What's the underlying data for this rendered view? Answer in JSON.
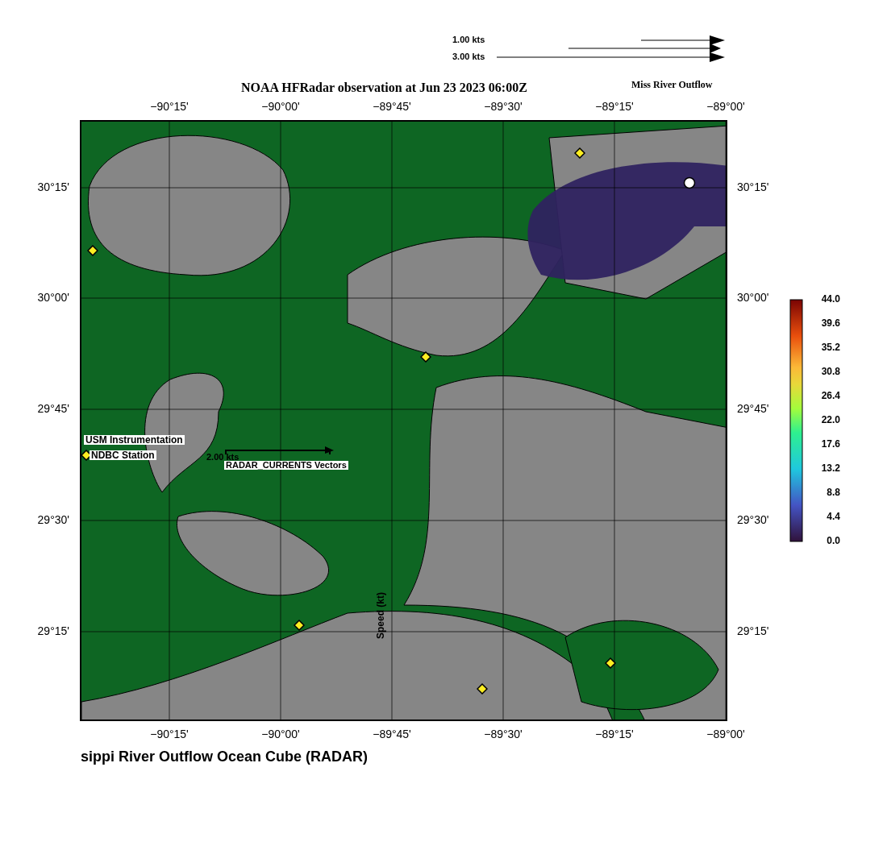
{
  "scale_legend": [
    {
      "label": "1.00 kts"
    },
    {
      "label": "3.00 kts"
    }
  ],
  "title": "NOAA HFRadar observation at Jun 23 2023 06:00Z",
  "subtitle": "Miss River Outflow",
  "map": {
    "kind": "picture",
    "top_ticks": [
      "−90°15'",
      "−90°00'",
      "−89°45'",
      "−89°30'",
      "−89°15'",
      "−89°00'"
    ],
    "left_ticks": [
      "30°15'",
      "30°00'",
      "29°45'",
      "29°30'",
      "29°15'"
    ],
    "right_ticks": [
      "30°15'",
      "30°00'",
      "29°45'",
      "29°30'",
      "29°15'"
    ],
    "bottom_ticks": [
      "−90°15'",
      "−90°00'",
      "−89°45'",
      "−89°30'",
      "−89°15'",
      "−89°00'"
    ],
    "legend_labels": [
      "USM Instrumentation",
      "NDBC Station"
    ],
    "vector_scale": "2.00 kts",
    "vector_label": "RADAR_CURRENTS Vectors",
    "speed_label": "Speed (kt)"
  },
  "colorbar": {
    "ticks": [
      "44.0",
      "39.6",
      "35.2",
      "30.8",
      "26.4",
      "22.0",
      "17.6",
      "13.2",
      "8.8",
      "4.4",
      "0.0"
    ]
  },
  "caption": "sippi River Outflow Ocean Cube (RADAR)"
}
